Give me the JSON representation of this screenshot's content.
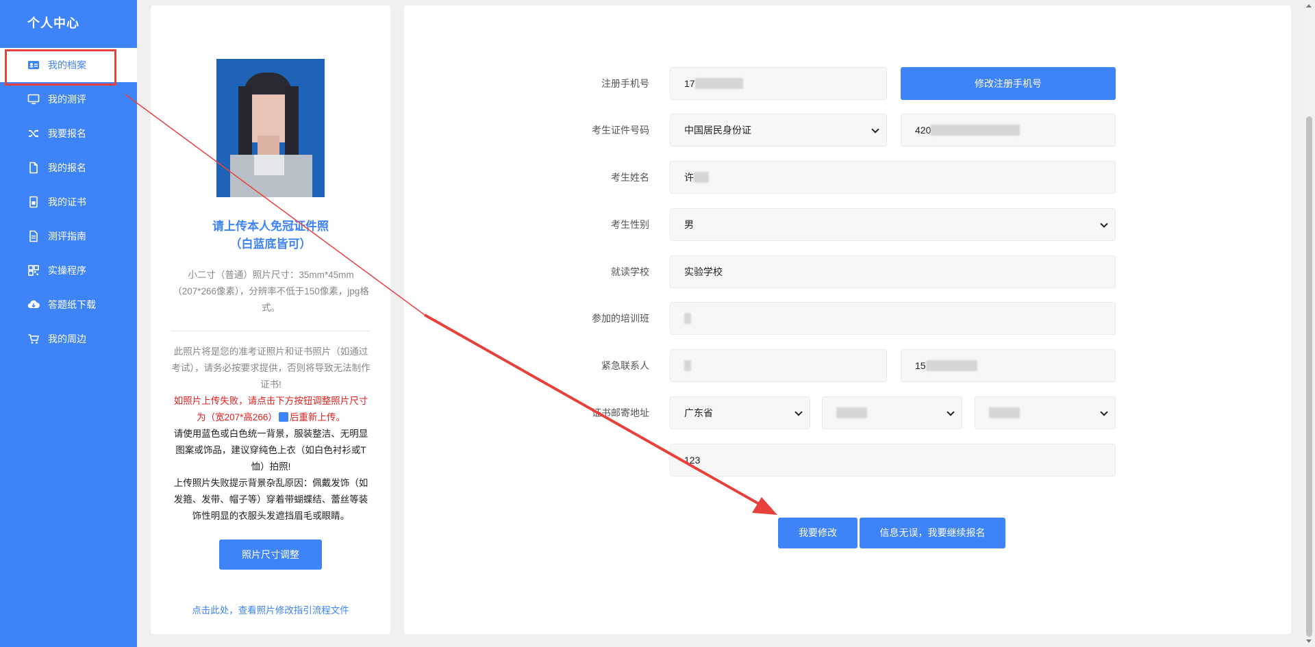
{
  "sidebar": {
    "title": "个人中心",
    "items": [
      {
        "label": "我的档案",
        "icon": "profile-card-icon",
        "active": true
      },
      {
        "label": "我的测评",
        "icon": "monitor-icon"
      },
      {
        "label": "我要报名",
        "icon": "shuffle-icon"
      },
      {
        "label": "我的报名",
        "icon": "document-icon"
      },
      {
        "label": "我的证书",
        "icon": "certificate-icon"
      },
      {
        "label": "测评指南",
        "icon": "guide-icon"
      },
      {
        "label": "实操程序",
        "icon": "qr-code-icon"
      },
      {
        "label": "答题纸下载",
        "icon": "cloud-download-icon"
      },
      {
        "label": "我的周边",
        "icon": "cart-icon"
      }
    ]
  },
  "photo_panel": {
    "upload_title_line1": "请上传本人免冠证件照",
    "upload_title_line2": "（白蓝底皆可）",
    "size_hint": "小二寸（普通）照片尺寸：35mm*45mm（207*266像素），分辨率不低于150像素，jpg格式。",
    "note_gray": "此照片将是您的准考证照片和证书照片（如通过考试），请务必按要求提供，否则将导致无法制作证书!",
    "note_red_1": "如照片上传失败，请点击下方按钮调整照片尺寸为（宽207*高266）",
    "note_red_2": "后重新上传。",
    "note_dark_1": "请使用蓝色或白色统一背景，服装整洁、无明显图案或饰品，建议穿纯色上衣（如白色衬衫或T恤）拍照!",
    "note_dark_2": "上传照片失败提示背景杂乱原因：佩戴发饰（如发箍、发带、帽子等）穿着带蝴蝶结、蕾丝等装饰性明显的衣服头发遮挡眉毛或眼睛。",
    "resize_button": "照片尺寸调整",
    "guide_link": "点击此处，查看照片修改指引流程文件"
  },
  "form": {
    "phone_label": "注册手机号",
    "phone_value_prefix": "17",
    "change_phone_button": "修改注册手机号",
    "id_label": "考生证件号码",
    "id_type": "中国居民身份证",
    "id_value_prefix": "420",
    "name_label": "考生姓名",
    "name_value_prefix": "许",
    "gender_label": "考生性别",
    "gender_value": "男",
    "school_label": "就读学校",
    "school_value": "实验学校",
    "training_label": "参加的培训班",
    "contact_label": "紧急联系人",
    "contact_phone_prefix": "15",
    "address_label": "证书邮寄地址",
    "province": "广东省",
    "address_detail": "123",
    "modify_button": "我要修改",
    "continue_button": "信息无误，我要继续报名"
  },
  "colors": {
    "primary": "#3f83f8",
    "highlight_box": "#e8413b",
    "annotation_arrow": "#e8413b",
    "warning_text": "#e02020"
  }
}
